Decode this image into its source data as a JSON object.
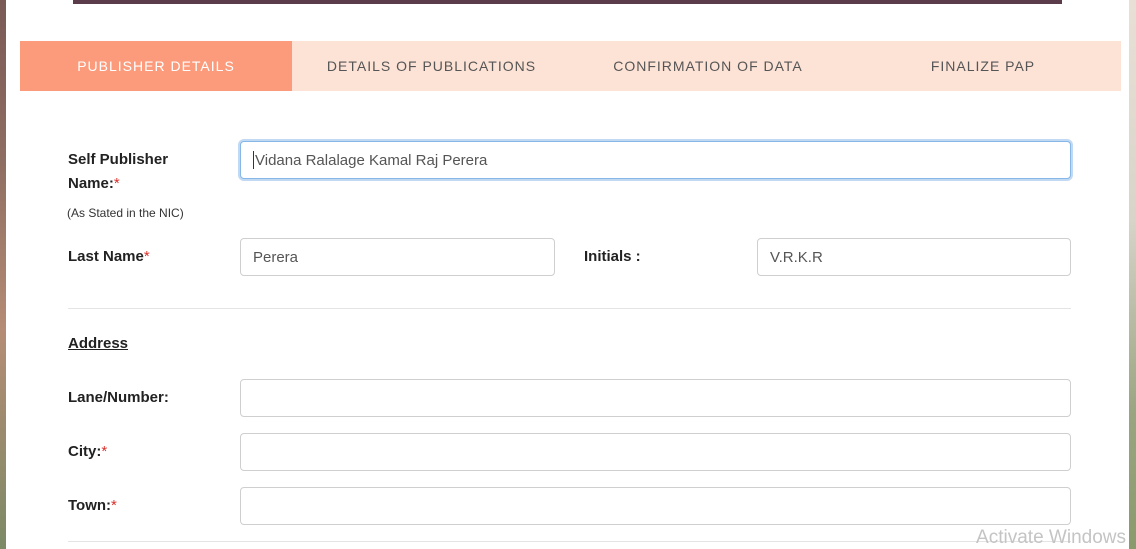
{
  "tabs": [
    {
      "label": "PUBLISHER DETAILS",
      "active": true
    },
    {
      "label": "DETAILS OF PUBLICATIONS",
      "active": false
    },
    {
      "label": "CONFIRMATION OF DATA",
      "active": false
    },
    {
      "label": "FINALIZE PAP",
      "active": false
    }
  ],
  "form": {
    "self_publisher_label_1": "Self Publisher",
    "self_publisher_label_2": "Name:",
    "required_mark": "*",
    "self_publisher_hint": "(As Stated in the NIC)",
    "self_publisher_value": "Vidana Ralalage Kamal Raj Perera",
    "last_name_label": "Last Name",
    "last_name_value": "Perera",
    "initials_label": "Initials :",
    "initials_value": "V.R.K.R",
    "address_title": "Address",
    "lane_label": "Lane/Number:",
    "lane_value": "",
    "city_label": "City:",
    "city_value": "",
    "town_label": "Town:",
    "town_value": ""
  },
  "colors": {
    "tab_active_bg": "#fb9b7c",
    "tab_bar_bg": "#fde2d6",
    "required": "#d9302c"
  },
  "watermark": "Activate Windows"
}
